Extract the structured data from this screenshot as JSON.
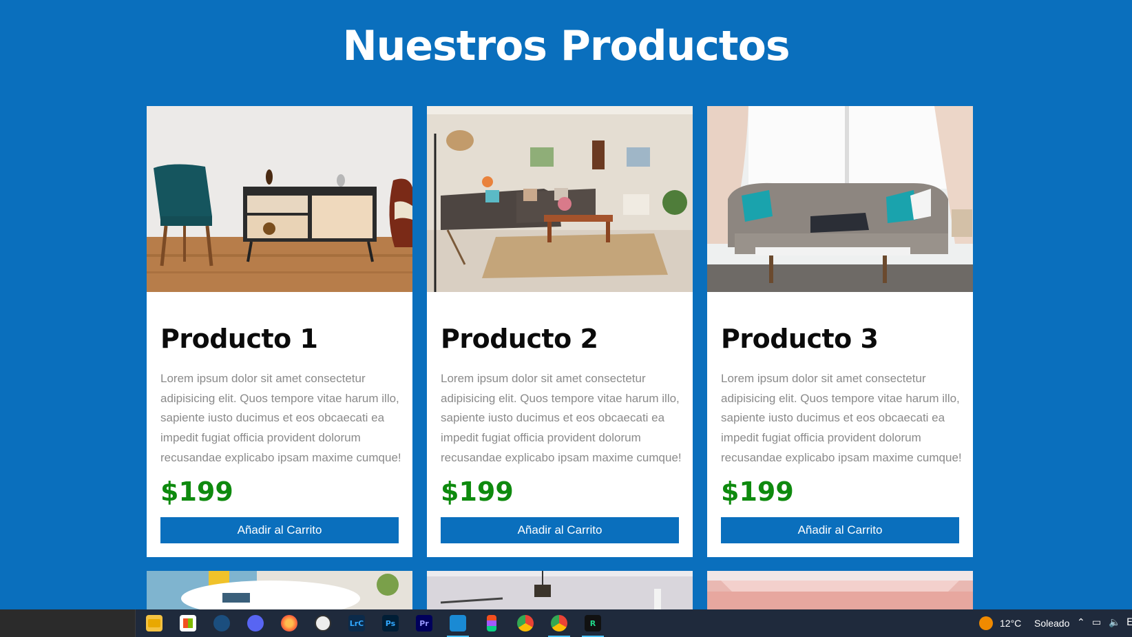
{
  "page": {
    "title": "Nuestros Productos"
  },
  "products": [
    {
      "name": "Producto 1",
      "description": "Lorem ipsum dolor sit amet consectetur adipisicing elit. Quos tempore vitae harum illo, sapiente iusto ducimus et eos obcaecati ea impedit fugiat officia provident dolorum recusandae explicabo ipsam maxime cumque!",
      "price": "$199",
      "button": "Añadir al Carrito"
    },
    {
      "name": "Producto 2",
      "description": "Lorem ipsum dolor sit amet consectetur adipisicing elit. Quos tempore vitae harum illo, sapiente iusto ducimus et eos obcaecati ea impedit fugiat officia provident dolorum recusandae explicabo ipsam maxime cumque!",
      "price": "$199",
      "button": "Añadir al Carrito"
    },
    {
      "name": "Producto 3",
      "description": "Lorem ipsum dolor sit amet consectetur adipisicing elit. Quos tempore vitae harum illo, sapiente iusto ducimus et eos obcaecati ea impedit fugiat officia provident dolorum recusandae explicabo ipsam maxime cumque!",
      "price": "$199",
      "button": "Añadir al Carrito"
    }
  ],
  "colors": {
    "background": "#0a6fbd",
    "button": "#0a6fbd",
    "price": "#0e8a0e",
    "card": "#ffffff"
  },
  "taskbar": {
    "apps": [
      {
        "name": "file-explorer-icon",
        "glyph": "",
        "color": "#f4c242"
      },
      {
        "name": "microsoft-store-icon",
        "glyph": "",
        "color": "#3a86d8"
      },
      {
        "name": "steam-icon",
        "glyph": "",
        "color": "#1b4e7e"
      },
      {
        "name": "discord-icon",
        "glyph": "",
        "color": "#5865f2"
      },
      {
        "name": "firefox-icon",
        "glyph": "",
        "color": "#ff7139"
      },
      {
        "name": "clock-app-icon",
        "glyph": "",
        "color": "#9aa0a6"
      },
      {
        "name": "lightroom-classic-icon",
        "glyph": "LrC",
        "color": "#0b2a4a"
      },
      {
        "name": "photoshop-icon",
        "glyph": "Ps",
        "color": "#001e36"
      },
      {
        "name": "premiere-icon",
        "glyph": "Pr",
        "color": "#00005b"
      },
      {
        "name": "vscode-icon",
        "glyph": "",
        "color": "#1a8ad4"
      },
      {
        "name": "figma-icon",
        "glyph": "",
        "color": "#a259ff"
      },
      {
        "name": "chrome-icon",
        "glyph": "",
        "color": "#34a853"
      },
      {
        "name": "chrome-profile-icon",
        "glyph": "",
        "color": "#4285f4"
      },
      {
        "name": "rider-icon",
        "glyph": "R",
        "color": "#111111"
      }
    ],
    "weather": {
      "temp": "12°C",
      "condition": "Soleado"
    },
    "lang": "E"
  }
}
